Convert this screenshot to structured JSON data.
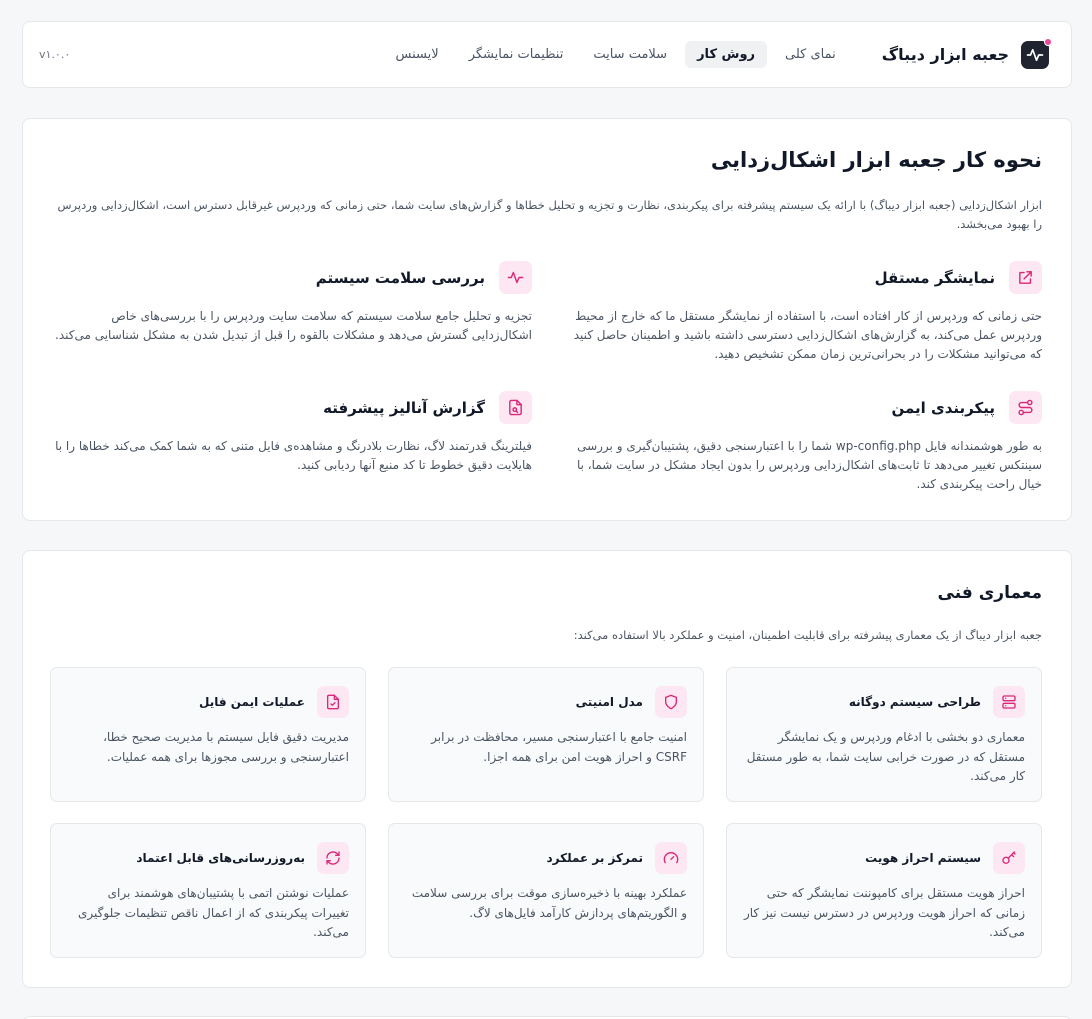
{
  "header": {
    "brand_title": "جعبه ابزار دیباگ",
    "nav": [
      {
        "label": "نمای کلی",
        "active": false
      },
      {
        "label": "روش کار",
        "active": true
      },
      {
        "label": "سلامت سایت",
        "active": false
      },
      {
        "label": "تنظیمات نمایشگر",
        "active": false
      },
      {
        "label": "لایسنس",
        "active": false
      }
    ],
    "version": "v۱.۰.۰"
  },
  "how_it_works": {
    "title": "نحوه کار جعبه ابزار اشکال‌زدایی",
    "lead": "ابزار اشکال‌زدایی (جعبه ابزار دیباگ) با ارائه یک سیستم پیشرفته برای پیکربندی، نظارت و تجزیه و تحلیل خطاها و گزارش‌های سایت شما، حتی زمانی که وردپرس غیرقابل دسترس است، اشکال‌زدایی وردپرس را بهبود می‌بخشد.",
    "features": [
      {
        "title": "نمایشگر مستقل",
        "icon": "external-link-icon",
        "desc": "حتی زمانی که وردپرس از کار افتاده است، با استفاده از نمایشگر مستقل ما که خارج از محیط وردپرس عمل می‌کند، به گزارش‌های اشکال‌زدایی دسترسی داشته باشید و اطمینان حاصل کنید که می‌توانید مشکلات را در بحرانی‌ترین زمان ممکن تشخیص دهید."
      },
      {
        "title": "بررسی سلامت سیستم",
        "icon": "activity-icon",
        "desc": "تجزیه و تحلیل جامع سلامت سیستم که سلامت سایت وردپرس را با بررسی‌های خاص اشکال‌زدایی گسترش می‌دهد و مشکلات بالقوه را قبل از تبدیل شدن به مشکل شناسایی می‌کند."
      },
      {
        "title": "پیکربندی ایمن",
        "icon": "route-icon",
        "desc": "به طور هوشمندانه فایل wp-config.php شما را با اعتبارسنجی دقیق، پشتیبان‌گیری و بررسی سینتکس تغییر می‌دهد تا ثابت‌های اشکال‌زدایی وردپرس را بدون ایجاد مشکل در سایت شما، با خیال راحت پیکربندی کند."
      },
      {
        "title": "گزارش آنالیز پیشرفته",
        "icon": "file-search-icon",
        "desc": "فیلترینگ قدرتمند لاگ، نظارت بلادرنگ و مشاهده‌ی فایل متنی که به شما کمک می‌کند خطاها را با هایلایت دقیق خطوط تا کد منبع آنها ردیابی کنید."
      }
    ]
  },
  "architecture": {
    "title": "معماری فنی",
    "lead": "جعبه ابزار دیباگ از یک معماری پیشرفته برای قابلیت اطمینان، امنیت و عملکرد بالا استفاده می‌کند:",
    "items": [
      {
        "title": "طراحی سیستم دوگانه",
        "icon": "server-icon",
        "desc": "معماری دو بخشی با ادغام وردپرس و یک نمایشگر مستقل که در صورت خرابی سایت شما، به طور مستقل کار می‌کند."
      },
      {
        "title": "مدل امنیتی",
        "icon": "shield-icon",
        "desc": "امنیت جامع با اعتبارسنجی مسیر، محافظت در برابر CSRF و احراز هویت امن برای همه اجزا."
      },
      {
        "title": "عملیات ایمن فایل",
        "icon": "file-check-icon",
        "desc": "مدیریت دقیق فایل سیستم با مدیریت صحیح خطا، اعتبارسنجی و بررسی مجوزها برای همه عملیات."
      },
      {
        "title": "سیستم احراز هویت",
        "icon": "key-icon",
        "desc": "احراز هویت مستقل برای کامپوننت نمایشگر که حتی زمانی که احراز هویت وردپرس در دسترس نیست نیز کار می‌کند."
      },
      {
        "title": "تمرکز بر عملکرد",
        "icon": "gauge-icon",
        "desc": "عملکرد بهینه با ذخیره‌سازی موقت برای بررسی سلامت و الگوریتم‌های پردازش کارآمد فایل‌های لاگ."
      },
      {
        "title": "به‌روزرسانی‌های قابل اعتماد",
        "icon": "refresh-icon",
        "desc": "عملیات نوشتن اتمی با پشتیبان‌های هوشمند برای تغییرات پیکربندی که از اعمال ناقص تنظیمات جلوگیری می‌کند."
      }
    ]
  },
  "colors": {
    "accent": "#db2777",
    "accent_bg": "#fce7f3",
    "brand_bg": "#1f2430"
  }
}
